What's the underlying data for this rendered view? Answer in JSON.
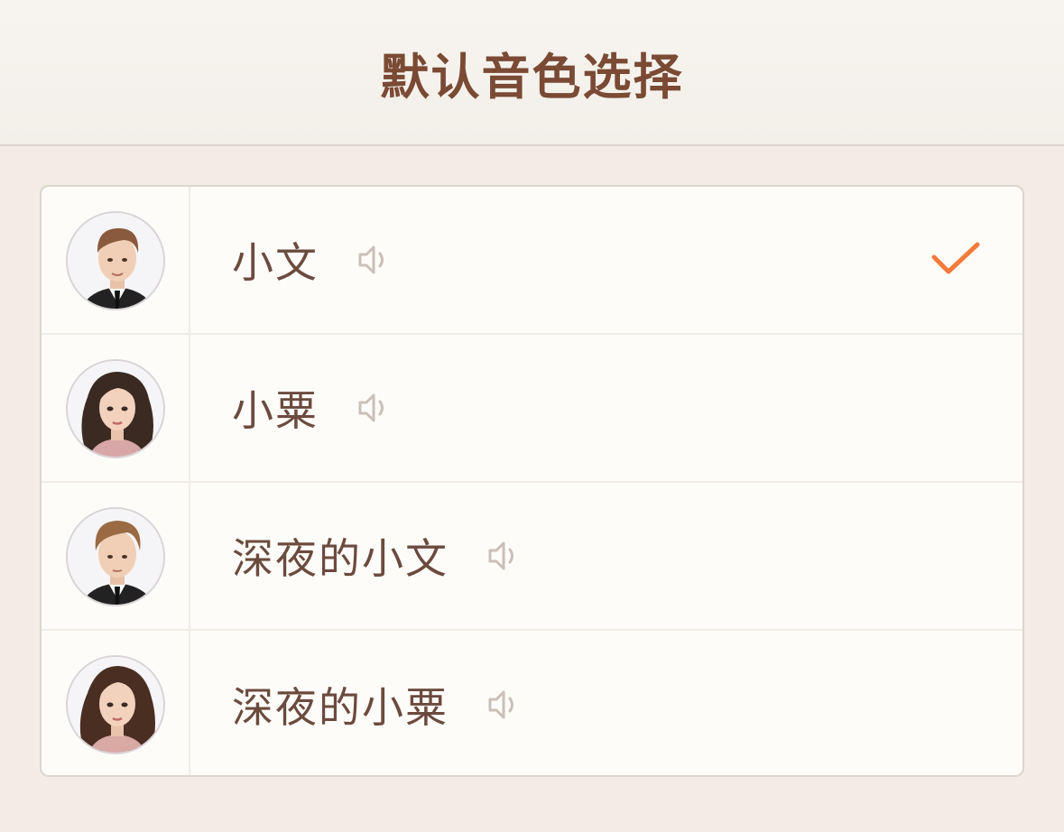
{
  "header": {
    "title": "默认音色选择"
  },
  "voices": [
    {
      "name": "小文",
      "avatar": "male-avatar-icon",
      "selected": true
    },
    {
      "name": "小粟",
      "avatar": "female-avatar-icon",
      "selected": false
    },
    {
      "name": "深夜的小文",
      "avatar": "male-avatar-icon",
      "selected": false
    },
    {
      "name": "深夜的小粟",
      "avatar": "female-avatar-icon",
      "selected": false
    }
  ],
  "icons": {
    "speaker": "speaker-icon",
    "check": "checkmark-icon"
  },
  "colors": {
    "accent": "#f47b3c",
    "title": "#7a4a34",
    "text": "#6b4b3e",
    "speaker": "#cbbfb8",
    "background": "#f2ece4",
    "card": "#fefcf9"
  }
}
